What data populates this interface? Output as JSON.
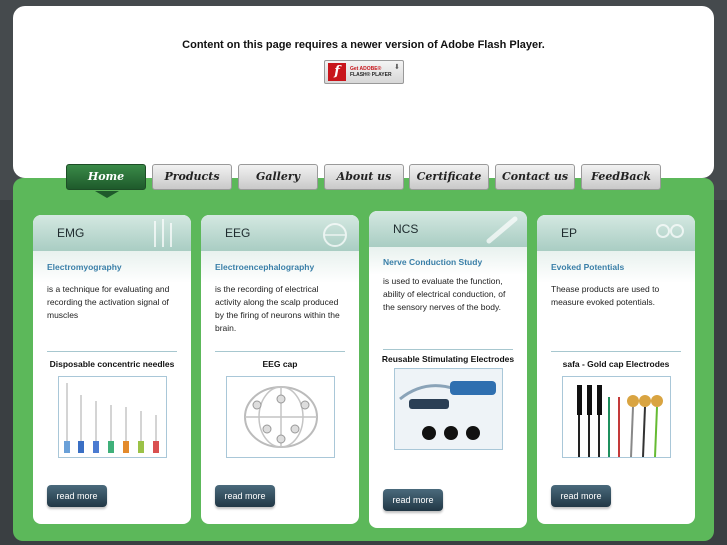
{
  "flash": {
    "message": "Content on this page requires a newer version of Adobe Flash Player.",
    "badge_line1": "Get ADOBE®",
    "badge_line2": "FLASH® PLAYER"
  },
  "nav": {
    "items": [
      {
        "label": "Home",
        "active": true
      },
      {
        "label": "Products"
      },
      {
        "label": "Gallery"
      },
      {
        "label": "About us"
      },
      {
        "label": "Certificate"
      },
      {
        "label": "Contact us"
      },
      {
        "label": "FeedBack"
      }
    ]
  },
  "cards": [
    {
      "title": "EMG",
      "subtitle": "Electromyography",
      "description": "is a technique for evaluating and recording the activation signal of muscles",
      "product": "Disposable concentric needles",
      "button": "read more",
      "icon": "needles-icon"
    },
    {
      "title": "EEG",
      "subtitle": "Electroencephalography",
      "description": "is the recording of electrical activity along the scalp produced by the firing of neurons within the brain.",
      "product": "EEG cap",
      "button": "read more",
      "icon": "eeg-cap-icon"
    },
    {
      "title": "NCS",
      "subtitle": "Nerve Conduction Study",
      "description": "is used to evaluate the function, ability of electrical conduction, of the sensory nerves of the body.",
      "product": "Reusable Stimulating Electrodes",
      "button": "read more",
      "icon": "stimulating-electrode-icon"
    },
    {
      "title": "EP",
      "subtitle": "Evoked Potentials",
      "description": "Thease products are used to measure evoked potentials.",
      "product": "safa - Gold cap Electrodes",
      "button": "read more",
      "icon": "gold-cap-electrodes-icon"
    }
  ],
  "colors": {
    "panel_green": "#5cb85a",
    "nav_active": "#1e5a2b",
    "subtitle_blue": "#3a7fa8"
  }
}
